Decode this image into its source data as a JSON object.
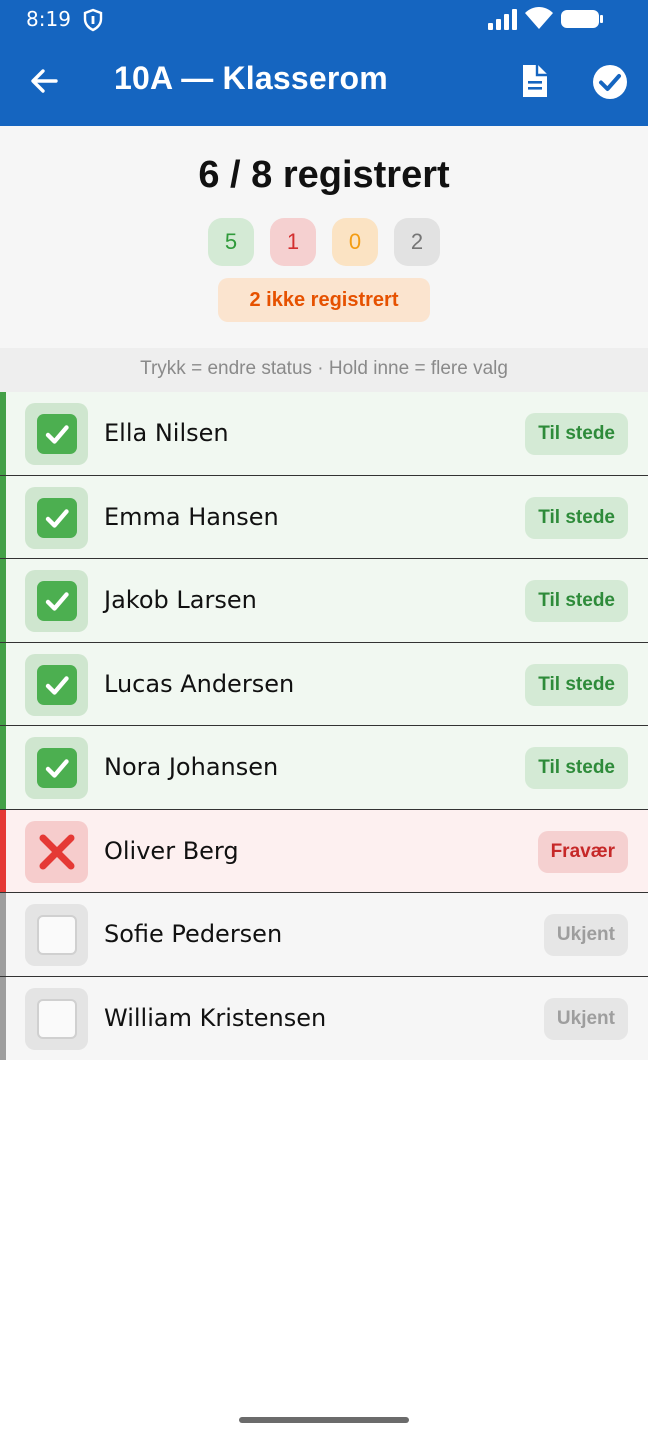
{
  "status_bar": {
    "time": "8:19"
  },
  "app_bar": {
    "title": "10A — Klasserom",
    "back_icon": "arrow-back-icon",
    "report_icon": "document-icon",
    "confirm_icon": "check-circle-icon"
  },
  "summary": {
    "count_text": "6 / 8 registrert",
    "present_count": "5",
    "absent_count": "1",
    "late_count": "0",
    "unknown_count": "2",
    "not_registered_text": "2 ikke registrert"
  },
  "hint": "Trykk = endre status · Hold inne = flere valg",
  "students": [
    {
      "name": "Ella Nilsen",
      "status": "Til stede"
    },
    {
      "name": "Emma Hansen",
      "status": "Til stede"
    },
    {
      "name": "Jakob Larsen",
      "status": "Til stede"
    },
    {
      "name": "Lucas Andersen",
      "status": "Til stede"
    },
    {
      "name": "Nora Johansen",
      "status": "Til stede"
    },
    {
      "name": "Oliver Berg",
      "status": "Fravær"
    },
    {
      "name": "Sofie Pedersen",
      "status": "Ukjent"
    },
    {
      "name": "William Kristensen",
      "status": "Ukjent"
    }
  ],
  "colors": {
    "app_bar": "#1565c0",
    "present": "#43a047",
    "absent": "#e53935",
    "unknown": "#9e9e9e",
    "not_registered": "#e65100"
  }
}
